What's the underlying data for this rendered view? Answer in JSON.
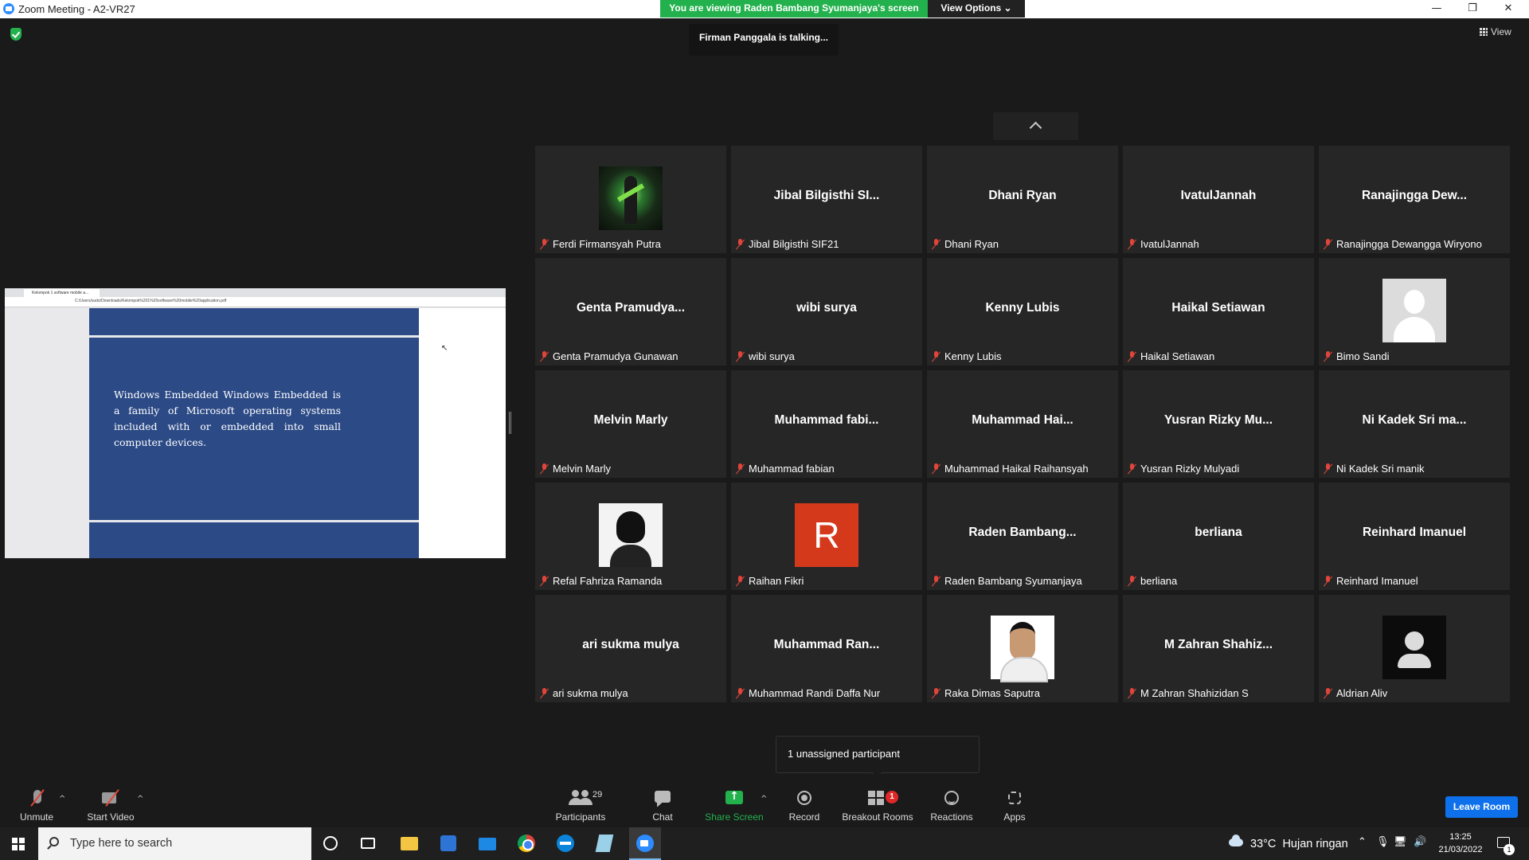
{
  "window": {
    "title": "Zoom Meeting - A2-VR27",
    "minimize": "—",
    "restore": "❐",
    "close": "✕"
  },
  "share_banner": {
    "text": "You are viewing Raden Bambang Syumanjaya's screen",
    "view_options": "View Options ⌄"
  },
  "talking_indicator": "Firman Panggala is talking...",
  "view_button": "View",
  "shared_screen": {
    "tab_title": "Kelompok 1 software mobile a...",
    "url": "C:/Users/sudo/Downloads/Kelompok%201%20software%20mobile%20application.pdf",
    "slide_text": "Windows Embedded Windows Embedded is a family of Microsoft operating systems included with or embedded into small computer devices."
  },
  "gallery": {
    "tiles": [
      {
        "big": "",
        "name": "Ferdi Firmansyah Putra",
        "avatar": "game"
      },
      {
        "big": "Jibal Bilgisthi SI...",
        "name": "Jibal Bilgisthi SIF21"
      },
      {
        "big": "Dhani Ryan",
        "name": "Dhani Ryan"
      },
      {
        "big": "IvatulJannah",
        "name": "IvatulJannah"
      },
      {
        "big": "Ranajingga Dew...",
        "name": "Ranajingga Dewangga Wiryono"
      },
      {
        "big": "Genta Pramudya...",
        "name": "Genta Pramudya Gunawan"
      },
      {
        "big": "wibi surya",
        "name": "wibi surya"
      },
      {
        "big": "Kenny Lubis",
        "name": "Kenny Lubis"
      },
      {
        "big": "Haikal Setiawan",
        "name": "Haikal Setiawan"
      },
      {
        "big": "",
        "name": "Bimo Sandi",
        "avatar": "blank"
      },
      {
        "big": "Melvin Marly",
        "name": "Melvin Marly"
      },
      {
        "big": "Muhammad fabi...",
        "name": "Muhammad fabian"
      },
      {
        "big": "Muhammad Hai...",
        "name": "Muhammad Haikal Raihansyah"
      },
      {
        "big": "Yusran Rizky Mu...",
        "name": "Yusran Rizky Mulyadi"
      },
      {
        "big": "Ni Kadek Sri ma...",
        "name": "Ni Kadek Sri manik"
      },
      {
        "big": "",
        "name": "Refal Fahriza Ramanda",
        "avatar": "cap"
      },
      {
        "big": "",
        "name": "Raihan Fikri",
        "avatar": "letter",
        "letter": "R"
      },
      {
        "big": "Raden Bambang...",
        "name": "Raden Bambang Syumanjaya"
      },
      {
        "big": "berliana",
        "name": "berliana"
      },
      {
        "big": "Reinhard Imanuel",
        "name": "Reinhard Imanuel"
      },
      {
        "big": "ari sukma mulya",
        "name": "ari sukma mulya"
      },
      {
        "big": "Muhammad Ran...",
        "name": "Muhammad Randi Daffa Nur"
      },
      {
        "big": "",
        "name": "Raka Dimas Saputra",
        "avatar": "photo"
      },
      {
        "big": "M Zahran Shahiz...",
        "name": "M Zahran Shahizidan S"
      },
      {
        "big": "",
        "name": "Aldrian Aliv",
        "avatar": "dark"
      }
    ]
  },
  "unassigned_popup": "1 unassigned participant",
  "toolbar": {
    "unmute": "Unmute",
    "start_video": "Start Video",
    "participants": "Participants",
    "participants_count": "29",
    "chat": "Chat",
    "share_screen": "Share Screen",
    "record": "Record",
    "breakout_rooms": "Breakout Rooms",
    "breakout_badge": "1",
    "reactions": "Reactions",
    "apps": "Apps",
    "leave_room": "Leave Room",
    "caret": "^"
  },
  "taskbar": {
    "search_placeholder": "Type here to search",
    "weather": "33°C  Hujan ringan",
    "time": "13:25",
    "date": "21/03/2022",
    "notification_count": "1"
  },
  "colors": {
    "share_green": "#23b14d",
    "leave_blue": "#0e71eb",
    "muted_red": "#e0453a",
    "slide_blue": "#2c4a86"
  }
}
